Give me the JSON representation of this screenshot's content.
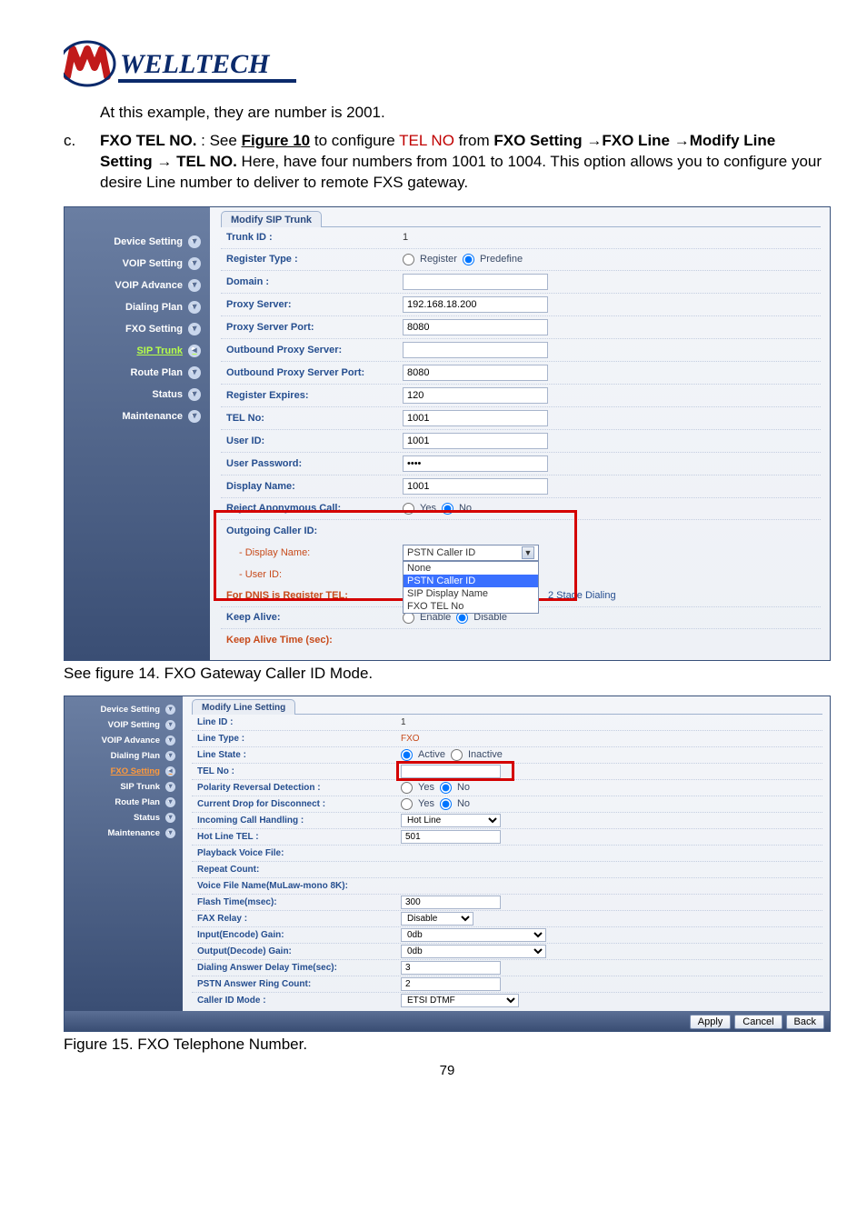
{
  "logo_text": "WELLTECH",
  "intro_line": "At this example, they are number is 2001.",
  "list_marker": "c.",
  "item_c": {
    "lead": "FXO TEL NO.",
    "see": " : See ",
    "fig_ref": "Figure 10",
    "mid1": " to configure ",
    "tel_no_red": "TEL NO",
    "mid2": " from ",
    "fxo_setting": "FXO Setting",
    "arrow": " → ",
    "fxo_line": "FXO Line",
    "modify": "Modify Line Setting",
    "tel_no": "TEL NO.",
    "tail": " Here, have four numbers from 1001 to 1004. This option allows you to configure your desire Line number to deliver to remote FXS gateway."
  },
  "sidebar1": [
    "Device Setting",
    "VOIP Setting",
    "VOIP Advance",
    "Dialing Plan",
    "FXO Setting",
    "SIP Trunk",
    "Route Plan",
    "Status",
    "Maintenance"
  ],
  "panel1": {
    "tab": "Modify SIP Trunk",
    "rows": {
      "trunk_id_lbl": "Trunk ID :",
      "trunk_id_val": "1",
      "reg_type_lbl": "Register Type :",
      "reg_type_opts": [
        "Register",
        "Predefine"
      ],
      "domain_lbl": "Domain :",
      "proxy_lbl": "Proxy Server:",
      "proxy_val": "192.168.18.200",
      "proxy_port_lbl": "Proxy Server Port:",
      "proxy_port_val": "8080",
      "ob_proxy_lbl": "Outbound Proxy Server:",
      "ob_port_lbl": "Outbound Proxy Server Port:",
      "ob_port_val": "8080",
      "reg_exp_lbl": "Register Expires:",
      "reg_exp_val": "120",
      "telno_lbl": "TEL No:",
      "telno_val": "1001",
      "userid_lbl": "User ID:",
      "userid_val": "1001",
      "userpw_lbl": "User Password:",
      "userpw_val": "••••",
      "dispname_lbl": "Display Name:",
      "dispname_val": "1001",
      "reject_lbl": "Reject Anonymous Call:",
      "reject_opts": [
        "Yes",
        "No"
      ],
      "out_cid_lbl": "Outgoing Caller ID:",
      "sub_disp_lbl": "- Display Name:",
      "sub_disp_sel": "PSTN Caller ID",
      "sub_disp_opts": [
        "None",
        "PSTN Caller ID",
        "SIP Display Name",
        "FXO TEL No"
      ],
      "sub_userid_lbl": "- User ID:",
      "dnis_lbl": "For DNIS is Register TEL:",
      "dnis_tag": "2 Stage Dialing",
      "keep_lbl": "Keep Alive:",
      "keep_opts": [
        "Enable",
        "Disable"
      ],
      "katime_lbl": "Keep Alive Time (sec):"
    }
  },
  "caption1": "See figure 14. FXO Gateway Caller ID Mode.",
  "sidebar2": [
    "Device Setting",
    "VOIP Setting",
    "VOIP Advance",
    "Dialing Plan",
    "FXO Setting",
    "SIP Trunk",
    "Route Plan",
    "Status",
    "Maintenance"
  ],
  "panel2": {
    "tab": "Modify Line Setting",
    "rows": {
      "lineid_lbl": "Line ID :",
      "lineid_val": "1",
      "linetype_lbl": "Line Type :",
      "linetype_val": "FXO",
      "linestate_lbl": "Line State :",
      "linestate_opts": [
        "Active",
        "Inactive"
      ],
      "telno_lbl": "TEL No :",
      "polarity_lbl": "Polarity Reversal Detection :",
      "polarity_opts": [
        "Yes",
        "No"
      ],
      "curdrop_lbl": "Current Drop for Disconnect :",
      "curdrop_opts": [
        "Yes",
        "No"
      ],
      "incall_lbl": "Incoming Call Handling :",
      "incall_sel": "Hot Line",
      "hotline_lbl": "Hot Line TEL :",
      "hotline_val": "501",
      "pbvoice_lbl": "Playback Voice File:",
      "repeat_lbl": "Repeat Count:",
      "vfname_lbl": "Voice File Name(MuLaw-mono 8K):",
      "flash_lbl": "Flash Time(msec):",
      "flash_val": "300",
      "fax_lbl": "FAX Relay :",
      "fax_sel": "Disable",
      "ingain_lbl": "Input(Encode) Gain:",
      "ingain_sel": "0db",
      "outgain_lbl": "Output(Decode) Gain:",
      "outgain_sel": "0db",
      "dadt_lbl": "Dialing Answer Delay Time(sec):",
      "dadt_val": "3",
      "pstnring_lbl": "PSTN Answer Ring Count:",
      "pstnring_val": "2",
      "cidmode_lbl": "Caller ID Mode :",
      "cidmode_sel": "ETSI DTMF"
    },
    "buttons": [
      "Apply",
      "Cancel",
      "Back"
    ]
  },
  "caption2": "Figure 15. FXO Telephone Number.",
  "page_num": "79"
}
